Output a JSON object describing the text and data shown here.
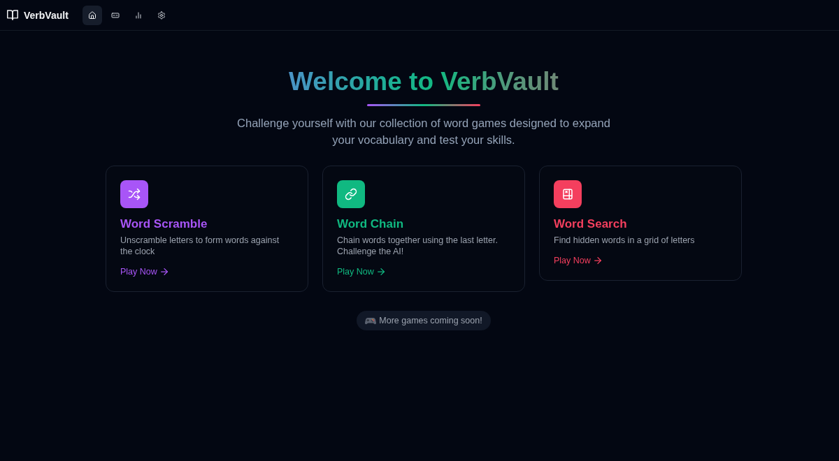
{
  "header": {
    "logo": "VerbVault",
    "nav": [
      {
        "kind": "home",
        "selected": true
      },
      {
        "kind": "games",
        "selected": false
      },
      {
        "kind": "stats",
        "selected": false
      },
      {
        "kind": "settings",
        "selected": false
      }
    ]
  },
  "hero": {
    "title": "Welcome to VerbVault",
    "subtitle": "Challenge yourself with our collection of word games designed to expand your vocabulary and test your skills."
  },
  "games": [
    {
      "kind": "shuffle",
      "title": "Word Scramble",
      "description": "Unscramble letters to form words against the clock",
      "link": "Play Now",
      "color": "#a855f7"
    },
    {
      "kind": "link",
      "title": "Word Chain",
      "description": "Chain words together using the last letter. Challenge the AI!",
      "link": "Play Now",
      "color": "#10b981"
    },
    {
      "kind": "grid",
      "title": "Word Search",
      "description": "Find hidden words in a grid of letters",
      "link": "Play Now",
      "color": "#f43f5e"
    }
  ],
  "notice": {
    "text": "More games coming soon!"
  }
}
